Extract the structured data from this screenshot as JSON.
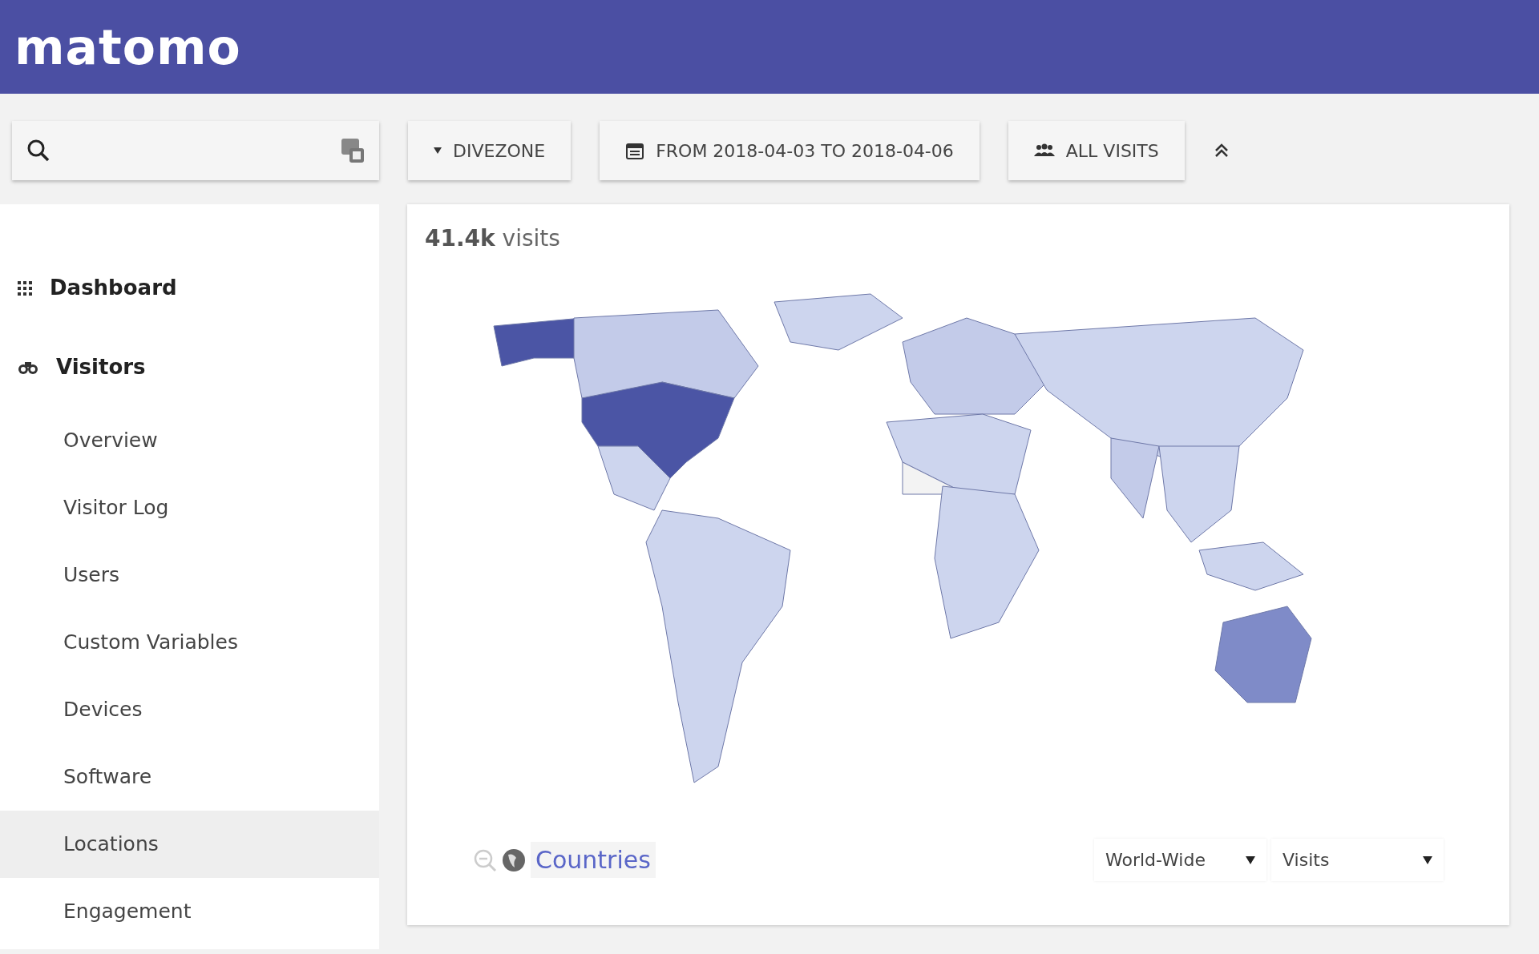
{
  "header": {
    "logo": "matomo"
  },
  "toolbar": {
    "buttons": [
      {
        "kind": "site",
        "label": "DIVEZONE"
      },
      {
        "kind": "date",
        "label": "FROM 2018-04-03 TO 2018-04-06"
      },
      {
        "kind": "segment",
        "label": "ALL VISITS"
      }
    ]
  },
  "sidebar": {
    "items": [
      {
        "kind": "dashboard",
        "label": "Dashboard",
        "selected": false
      },
      {
        "kind": "visitors",
        "label": "Visitors",
        "selected": false,
        "children": [
          {
            "label": "Overview",
            "selected": false
          },
          {
            "label": "Visitor Log",
            "selected": false
          },
          {
            "label": "Users",
            "selected": false
          },
          {
            "label": "Custom Variables",
            "selected": false
          },
          {
            "label": "Devices",
            "selected": false
          },
          {
            "label": "Software",
            "selected": false
          },
          {
            "label": "Locations",
            "selected": true
          },
          {
            "label": "Engagement",
            "selected": false
          }
        ]
      }
    ]
  },
  "map_card": {
    "title": "**41.4k** visits",
    "level_link": "Countries",
    "region_select": "World-Wide",
    "metric_select": "Visits"
  }
}
